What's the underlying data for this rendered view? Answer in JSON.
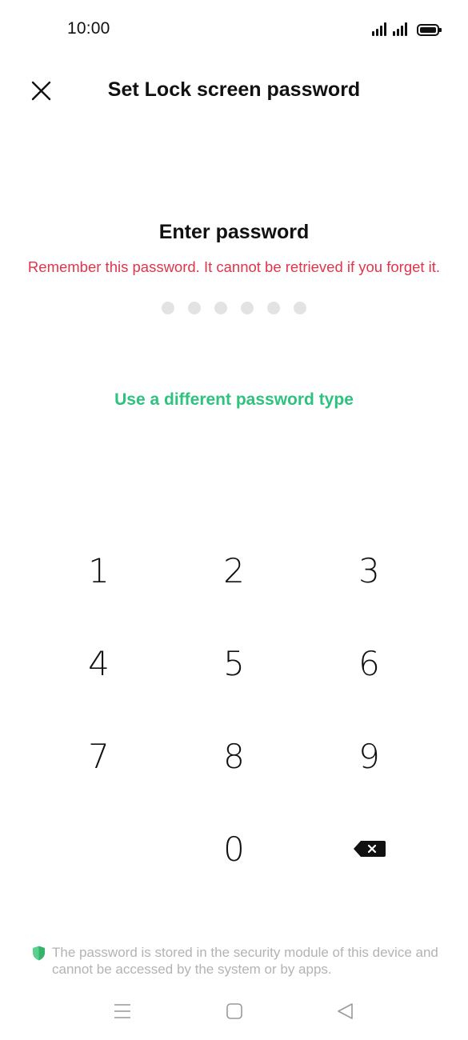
{
  "status_bar": {
    "time": "10:00",
    "icons": [
      "signal-icon",
      "signal-icon",
      "battery-icon"
    ]
  },
  "header": {
    "close_icon": "close-icon",
    "title": "Set Lock screen password"
  },
  "prompt": {
    "title": "Enter password",
    "warning": "Remember this password. It cannot be retrieved if you forget it.",
    "pin_length": 6,
    "alt_link": "Use a different password type"
  },
  "keypad": {
    "keys": [
      "1",
      "2",
      "3",
      "4",
      "5",
      "6",
      "7",
      "8",
      "9",
      "",
      "0",
      "backspace-icon"
    ]
  },
  "footer": {
    "icon": "shield-icon",
    "note": "The password is stored in the security module of this device and cannot be accessed by the system or by apps."
  },
  "nav_bar": {
    "buttons": [
      "menu-icon",
      "home-icon",
      "back-icon"
    ]
  },
  "colors": {
    "warning": "#e0354b",
    "accent": "#2ec27e",
    "pin_dot": "#e3e3e3",
    "footer_text": "#b3b3b3"
  }
}
